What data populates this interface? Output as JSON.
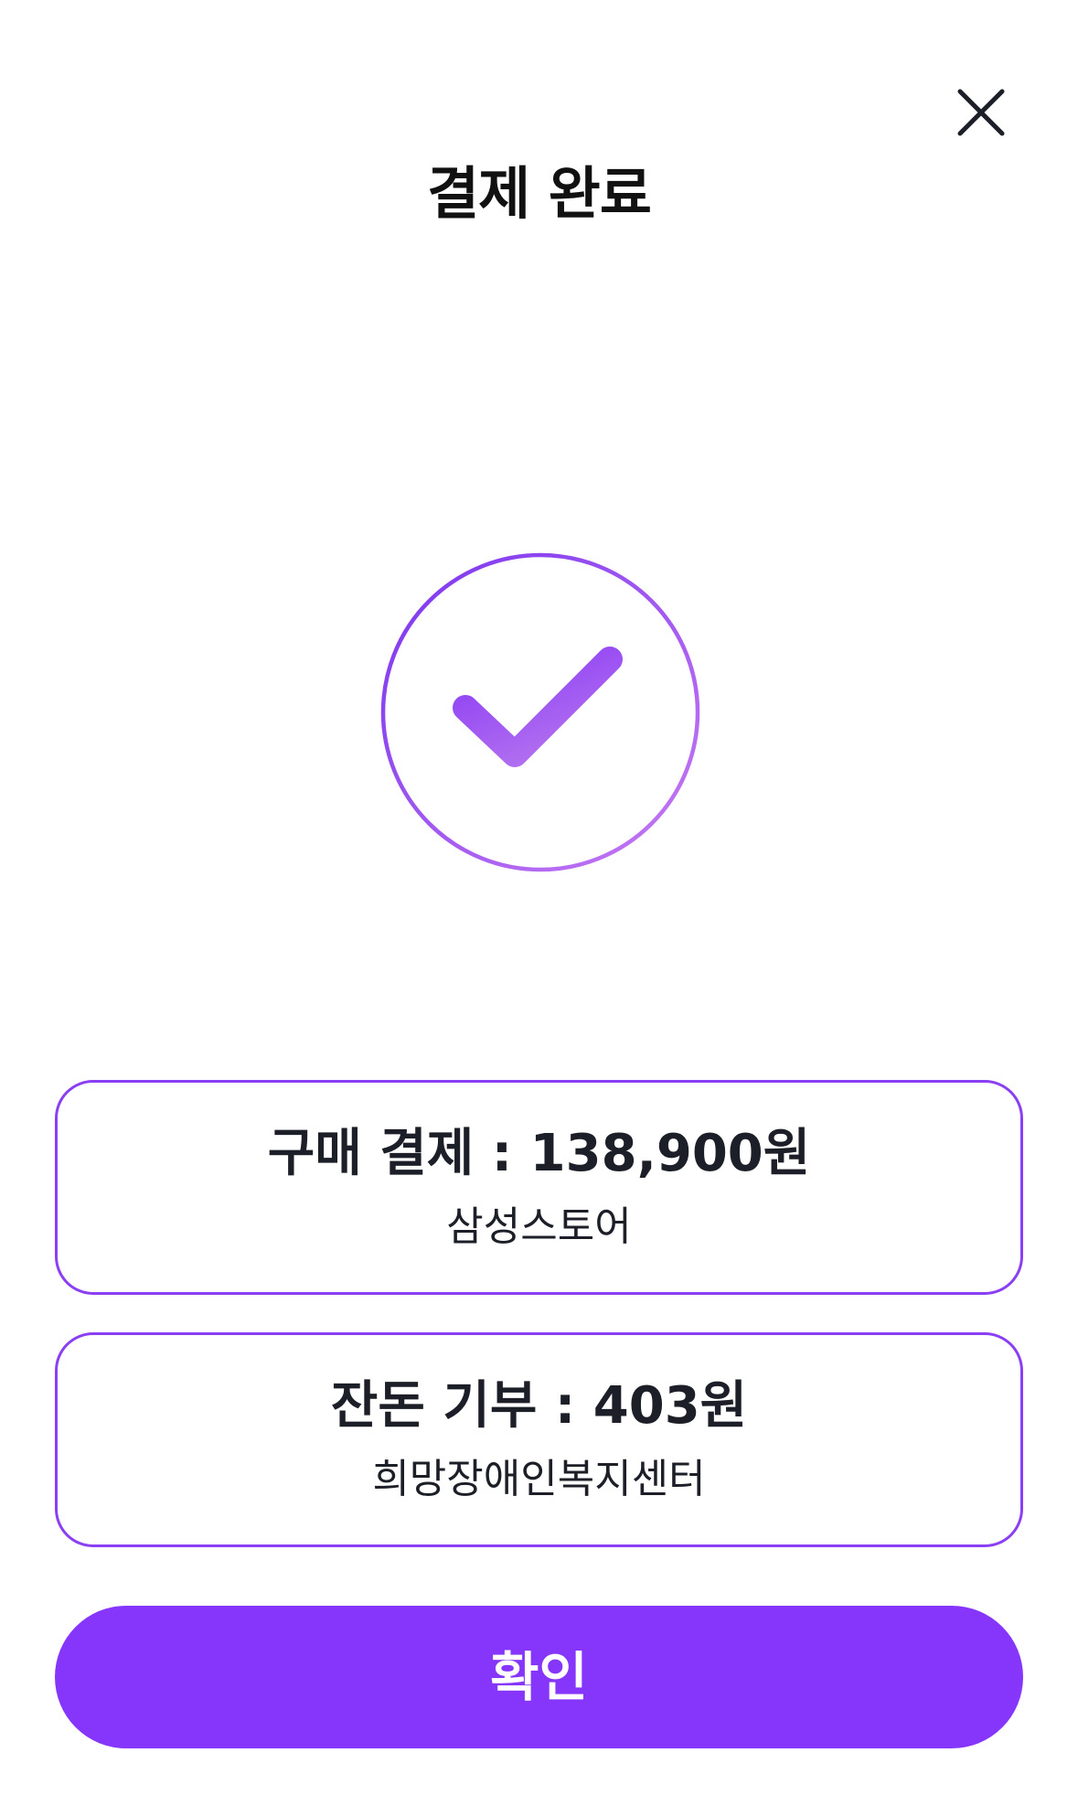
{
  "header": {
    "title": "결제 완료",
    "close_icon": "close-icon"
  },
  "status_icon": "check-circle-icon",
  "colors": {
    "accent": "#8636fb",
    "border": "#8a3ff2",
    "gradient_start": "#7c3aed",
    "gradient_end": "#c77bf2",
    "text": "#1c1f27"
  },
  "purchase": {
    "label": "구매 결제 : 138,900원",
    "merchant": "삼성스토어"
  },
  "donation": {
    "label": "잔돈 기부 : 403원",
    "recipient": "희망장애인복지센터"
  },
  "confirm_button": {
    "label": "확인"
  }
}
